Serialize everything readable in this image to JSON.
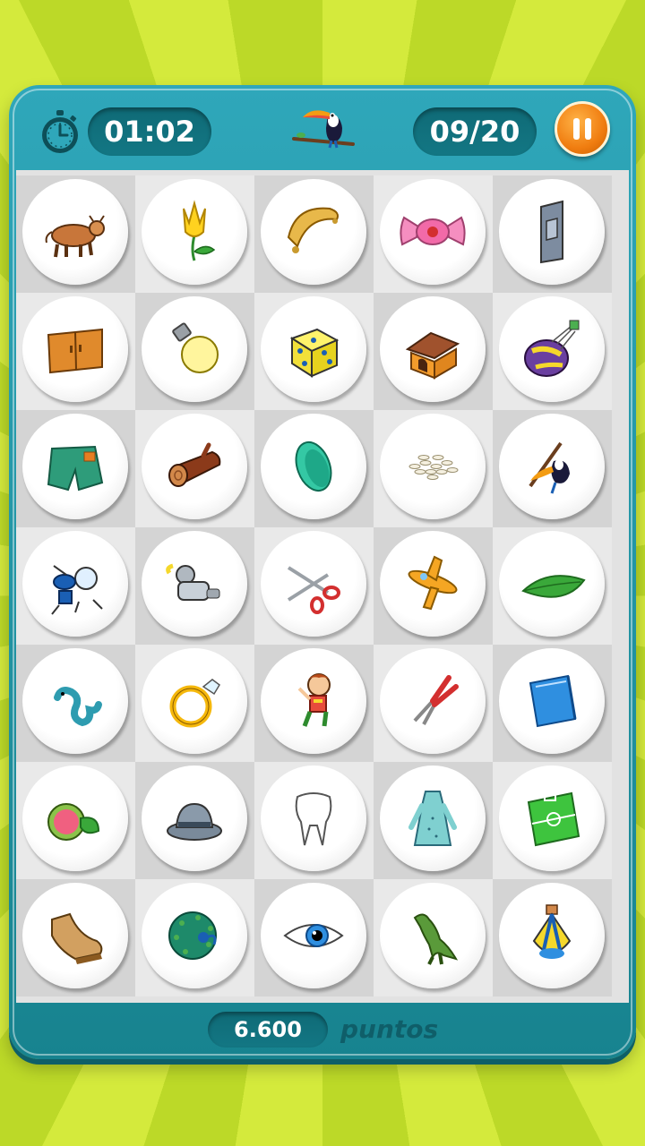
{
  "header": {
    "timer": "01:02",
    "counter": "09/20"
  },
  "footer": {
    "score": "6.600",
    "score_label": "puntos"
  },
  "colors": {
    "frame": "#1f96a6",
    "pill": "#12707c",
    "pause": "#f07d10",
    "background": "#c8e030"
  },
  "tiles": [
    {
      "icon": "cow-icon"
    },
    {
      "icon": "flower-icon"
    },
    {
      "icon": "necklace-icon"
    },
    {
      "icon": "candy-icon"
    },
    {
      "icon": "light-switch-icon"
    },
    {
      "icon": "cabinet-icon"
    },
    {
      "icon": "light-bulb-icon"
    },
    {
      "icon": "dice-icon"
    },
    {
      "icon": "doghouse-icon"
    },
    {
      "icon": "hot-air-balloon-icon"
    },
    {
      "icon": "shorts-icon"
    },
    {
      "icon": "log-icon"
    },
    {
      "icon": "bowl-icon"
    },
    {
      "icon": "rice-icon"
    },
    {
      "icon": "toucan-icon"
    },
    {
      "icon": "drum-kit-icon"
    },
    {
      "icon": "armor-icon"
    },
    {
      "icon": "scissors-icon"
    },
    {
      "icon": "airplane-icon"
    },
    {
      "icon": "leaf-icon"
    },
    {
      "icon": "seahorse-icon"
    },
    {
      "icon": "ring-icon"
    },
    {
      "icon": "boy-icon"
    },
    {
      "icon": "pliers-icon"
    },
    {
      "icon": "folder-icon"
    },
    {
      "icon": "guava-icon"
    },
    {
      "icon": "hat-icon"
    },
    {
      "icon": "tooth-icon"
    },
    {
      "icon": "dress-icon"
    },
    {
      "icon": "football-field-icon"
    },
    {
      "icon": "shoe-icon"
    },
    {
      "icon": "peacock-icon"
    },
    {
      "icon": "eye-icon"
    },
    {
      "icon": "dinosaur-icon"
    },
    {
      "icon": "lantern-icon"
    }
  ]
}
